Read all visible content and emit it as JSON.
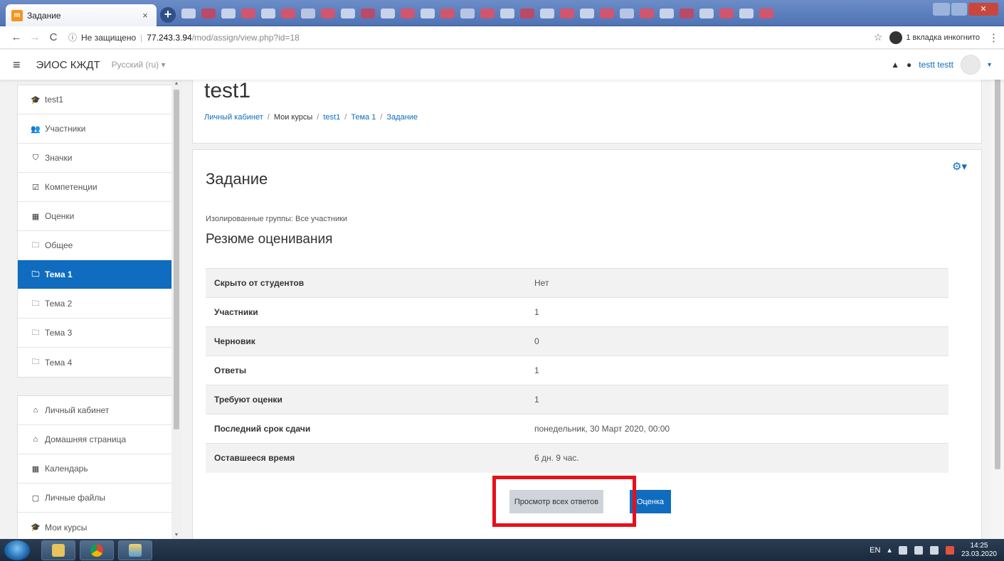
{
  "browser": {
    "tab_title": "Задание",
    "tab_favicon": "m",
    "tab_close": "×",
    "new_tab": "+",
    "url_insecure": "Не защищено",
    "url_host": "77.243.3.94",
    "url_path": "/mod/assign/view.php?id=18",
    "incognito_label": "1 вкладка инкогнито",
    "info_icon": "ⓘ",
    "back_icon": "←",
    "forward_icon": "→",
    "reload_icon": "C",
    "star_icon": "☆",
    "menu_icon": "⋮",
    "bookmark_colors": [
      "#c7d3ea",
      "#b94a6a",
      "#c7d3ea",
      "#d0556f",
      "#c7d3ea",
      "#d0556f",
      "#b8c6e4",
      "#d0556f"
    ]
  },
  "navbar": {
    "menu_icon": "≡",
    "site_name": "ЭИОС КЖДТ",
    "language": "Русский (ru) ▾",
    "user_name": "testt testt",
    "bell_icon": "▲",
    "message_icon": "●",
    "caret": "▾"
  },
  "sidebar": {
    "course_items": [
      {
        "icon": "🎓",
        "label": "test1"
      },
      {
        "icon": "👥",
        "label": "Участники"
      },
      {
        "icon": "⛉",
        "label": "Значки"
      },
      {
        "icon": "☑",
        "label": "Компетенции"
      },
      {
        "icon": "▦",
        "label": "Оценки"
      },
      {
        "icon": "🗀",
        "label": "Общее"
      },
      {
        "icon": "🗀",
        "label": "Тема 1"
      },
      {
        "icon": "🗀",
        "label": "Тема 2"
      },
      {
        "icon": "🗀",
        "label": "Тема 3"
      },
      {
        "icon": "🗀",
        "label": "Тема 4"
      }
    ],
    "site_items": [
      {
        "icon": "⌂",
        "label": "Личный кабинет"
      },
      {
        "icon": "⌂",
        "label": "Домашняя страница"
      },
      {
        "icon": "▦",
        "label": "Календарь"
      },
      {
        "icon": "▢",
        "label": "Личные файлы"
      },
      {
        "icon": "🎓",
        "label": "Мои курсы"
      }
    ],
    "active_label": "Тема 1"
  },
  "header": {
    "title": "test1",
    "breadcrumb": {
      "home": "Личный кабинет",
      "my_courses": "Мои курсы",
      "course": "test1",
      "section": "Тема 1",
      "activity": "Задание",
      "separator": "/"
    }
  },
  "main": {
    "title": "Задание",
    "gear_icon": "⚙▾",
    "groups_text": "Изолированные группы: Все участники",
    "summary_title": "Резюме оценивания",
    "summary": [
      {
        "label": "Скрыто от студентов",
        "value": "Нет"
      },
      {
        "label": "Участники",
        "value": "1"
      },
      {
        "label": "Черновик",
        "value": "0"
      },
      {
        "label": "Ответы",
        "value": "1"
      },
      {
        "label": "Требуют оценки",
        "value": "1"
      },
      {
        "label": "Последний срок сдачи",
        "value": "понедельник, 30 Март 2020, 00:00"
      },
      {
        "label": "Оставшееся время",
        "value": "6 дн. 9 час."
      }
    ],
    "view_all_button": "Просмотр всех ответов",
    "grade_button": "Оценка",
    "highlight_color": "#e8101a"
  },
  "taskbar": {
    "lang": "EN",
    "time": "14:25",
    "date": "23.03.2020",
    "tray_arrow": "▴"
  }
}
